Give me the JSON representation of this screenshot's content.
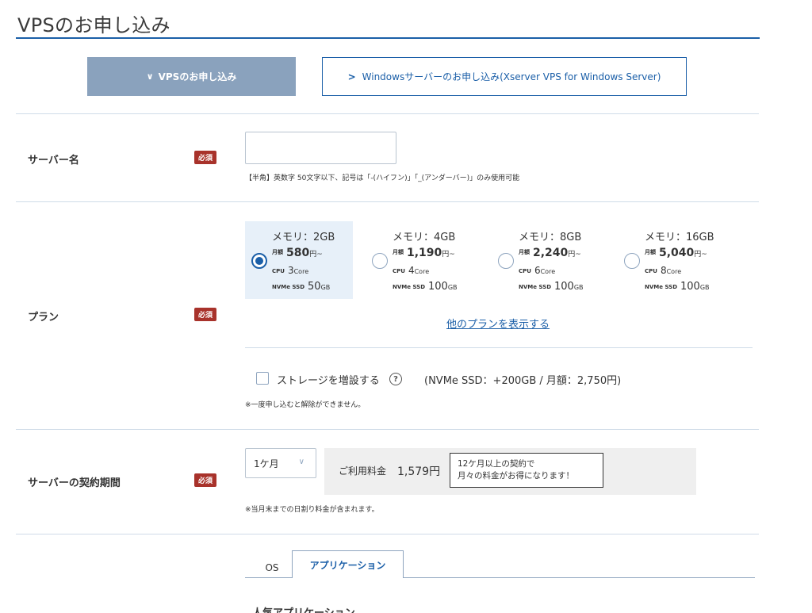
{
  "page": {
    "title": "VPSのお申し込み"
  },
  "type_tabs": {
    "vps_label": "VPSのお申し込み",
    "vps_chevron": "∨",
    "windows_label": "Windowsサーバーのお申し込み(Xserver VPS for Windows Server)",
    "windows_chevron": ">"
  },
  "required_label": "必須",
  "server_name": {
    "label": "サーバー名",
    "value": "",
    "hint": "【半角】英数字 50文字以下、記号は「-(ハイフン)」「_(アンダーバー)」のみ使用可能"
  },
  "plan": {
    "label": "プラン",
    "price_label": "月額",
    "price_unit": "円~",
    "cpu_label": "CPU",
    "cpu_unit": "Core",
    "ssd_label": "NVMe SSD",
    "ssd_unit": "GB",
    "selected_index": 0,
    "options": [
      {
        "memory": "メモリ：2GB",
        "price": "580",
        "cpu": "3",
        "ssd": "50"
      },
      {
        "memory": "メモリ：4GB",
        "price": "1,190",
        "cpu": "4",
        "ssd": "100"
      },
      {
        "memory": "メモリ：8GB",
        "price": "2,240",
        "cpu": "6",
        "ssd": "100"
      },
      {
        "memory": "メモリ：16GB",
        "price": "5,040",
        "cpu": "8",
        "ssd": "100"
      }
    ],
    "more_link": "他のプランを表示する"
  },
  "storage": {
    "label": "ストレージを増設する",
    "help_icon": "?",
    "detail": "(NVMe SSD：+200GB / 月額：2,750円)",
    "checked": false,
    "note": "※一度申し込むと解除ができません。"
  },
  "contract": {
    "label": "サーバーの契約期間",
    "selected": "1ケ月",
    "chevron": "∨",
    "fee_label": "ご利用料金",
    "fee_value": "1,579円",
    "promo_line1": "12ケ月以上の契約で",
    "promo_line2": "月々の料金がお得になります！",
    "note": "※当月末までの日割り料金が含まれます。"
  },
  "image_tabs": {
    "os": "OS",
    "application": "アプリケーション",
    "active": "application"
  },
  "popular_heading": "人気アプリケーション",
  "colors": {
    "accent": "#1b5fa8",
    "required_badge": "#a8322b",
    "active_tab": "#8aa2bd",
    "selected_plan_bg": "#e7f0f9"
  }
}
